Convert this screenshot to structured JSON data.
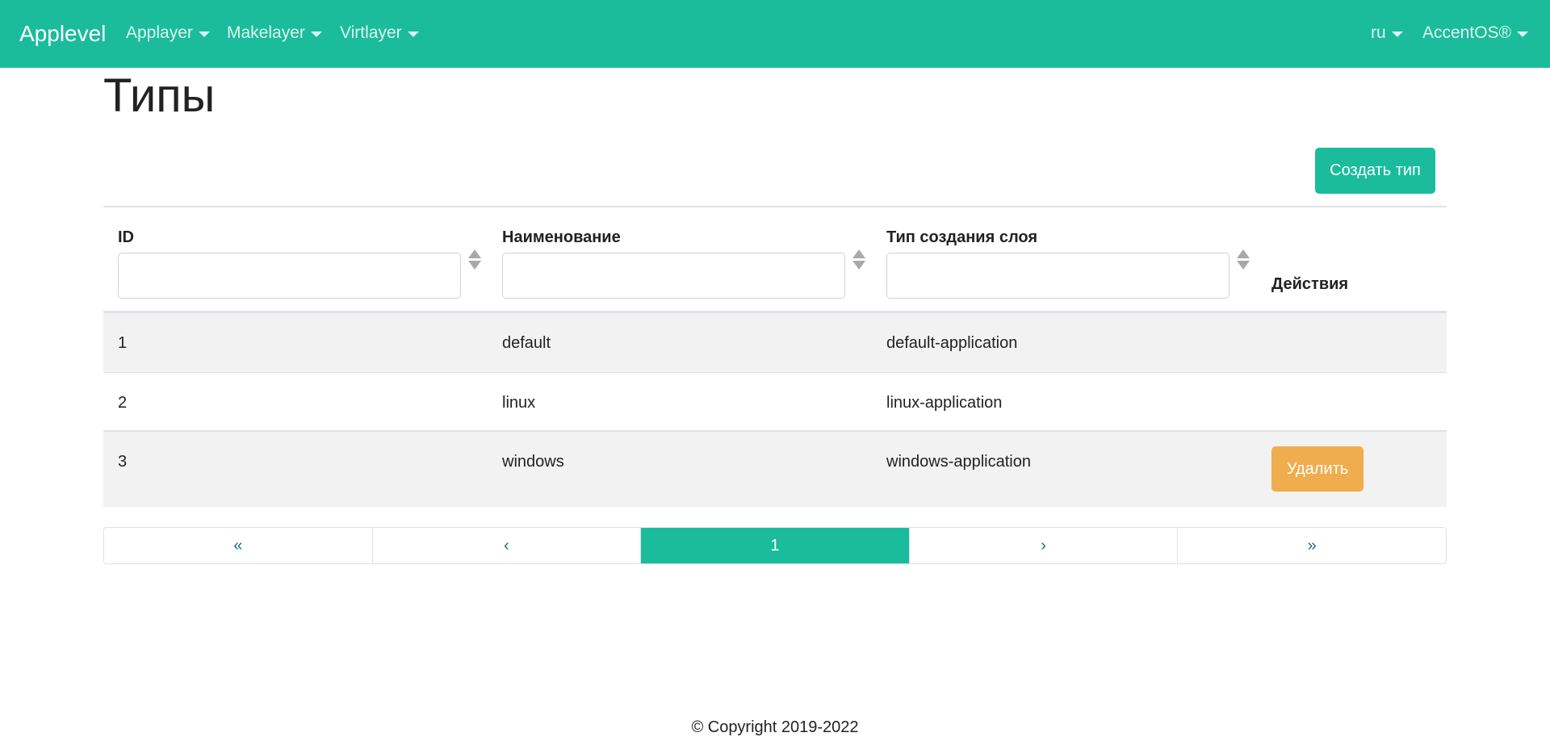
{
  "navbar": {
    "brand": "Applevel",
    "menus": [
      "Applayer",
      "Makelayer",
      "Virtlayer"
    ],
    "language": "ru",
    "account": "AccentOS®",
    "color": "#1abc9c"
  },
  "page": {
    "title": "Типы",
    "create_button": "Создать тип"
  },
  "table": {
    "columns": [
      "ID",
      "Наименование",
      "Тип создания слоя"
    ],
    "actions_header": "Действия",
    "filters": [
      "",
      "",
      ""
    ],
    "rows": [
      {
        "id": "1",
        "name": "default",
        "layer_type": "default-application",
        "action": ""
      },
      {
        "id": "2",
        "name": "linux",
        "layer_type": "linux-application",
        "action": ""
      },
      {
        "id": "3",
        "name": "windows",
        "layer_type": "windows-application",
        "action": "Удалить"
      }
    ]
  },
  "pagination": {
    "first": "«",
    "prev": "‹",
    "current": "1",
    "next": "›",
    "last": "»"
  },
  "footer": {
    "copyright": "© Copyright 2019-2022"
  },
  "colors": {
    "accent": "#1abc9c",
    "delete": "#f0ad4e",
    "stripe": "#f2f2f2"
  }
}
